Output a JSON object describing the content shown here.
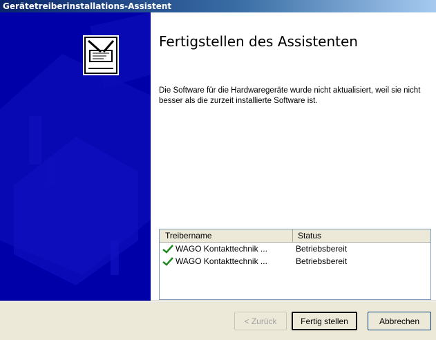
{
  "window": {
    "title": "Gerätetreiberinstallations-Assistent"
  },
  "page": {
    "heading": "Fertigstellen des Assistenten",
    "description": "Die Software für die Hardwaregeräte wurde nicht aktualisiert, weil sie nicht besser als die zurzeit installierte Software ist."
  },
  "driver_list": {
    "columns": [
      "Treibername",
      "Status"
    ],
    "rows": [
      {
        "name": "WAGO Kontakttechnik ...",
        "status": "Betriebsbereit",
        "icon": "checkmark-icon"
      },
      {
        "name": "WAGO Kontakttechnik ...",
        "status": "Betriebsbereit",
        "icon": "checkmark-icon"
      }
    ]
  },
  "buttons": {
    "back": "< Zurück",
    "finish": "Fertig stellen",
    "cancel": "Abbrechen"
  },
  "colors": {
    "banner": "#0000a8",
    "check": "#1f8a1f"
  }
}
